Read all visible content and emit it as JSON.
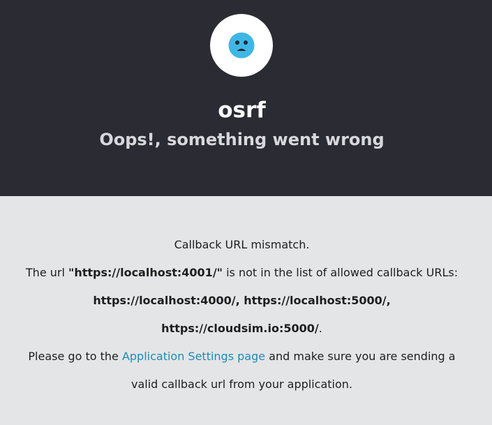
{
  "header": {
    "logo_icon": "sad-face-icon",
    "logo_color": "#3fb7e4",
    "background": "#2b2b33",
    "app_name": "osrf",
    "error_title": "Oops!, something went wrong"
  },
  "body": {
    "background": "#e4e5e6",
    "message": "Callback URL mismatch.",
    "url_prefix": "The url ",
    "bad_url": "\"https://localhost:4001/\"",
    "url_suffix": " is not in the list of allowed callback URLs:",
    "allowed_urls_line1": "https://localhost:4000/, https://localhost:5000/,",
    "allowed_urls_line2": "https://cloudsim.io:5000/",
    "allowed_urls_end": ".",
    "help_prefix": "Please go to the ",
    "settings_link": "Application Settings page",
    "help_suffix": " and make sure you are sending a",
    "help_line2": "valid callback url from your application.",
    "link_color": "#1e8bb8"
  }
}
